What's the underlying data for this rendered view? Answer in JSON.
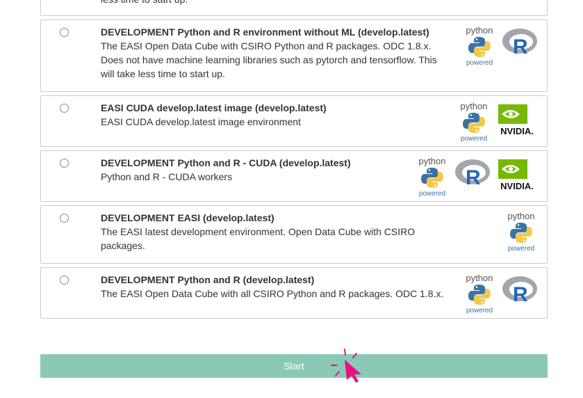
{
  "partial_top": {
    "description": "less time to start up."
  },
  "options": [
    {
      "title": "DEVELOPMENT Python and R environment without ML (develop.latest)",
      "description": "The EASI Open Data Cube with CSIRO Python and R packages. ODC 1.8.x. Does not have machine learning libraries such as pytorch and tensorflow. This will take less time to start up.",
      "logos": [
        "python",
        "r"
      ]
    },
    {
      "title": "EASI CUDA develop.latest image (develop.latest)",
      "description": "EASI CUDA develop.latest image environment",
      "logos": [
        "python",
        "nvidia"
      ]
    },
    {
      "title": "DEVELOPMENT Python and R - CUDA (develop.latest)",
      "description": "Python and R - CUDA workers",
      "logos": [
        "python",
        "r",
        "nvidia"
      ]
    },
    {
      "title": "DEVELOPMENT EASI (develop.latest)",
      "description": "The EASI latest development environment. Open Data Cube with CSIRO packages.",
      "logos": [
        "python"
      ]
    },
    {
      "title": "DEVELOPMENT Python and R (develop.latest)",
      "description": "The EASI Open Data Cube with all CSIRO Python and R packages. ODC 1.8.x.",
      "logos": [
        "python",
        "r"
      ]
    }
  ],
  "logo_text": {
    "python_top": "python",
    "python_bottom": "powered",
    "nvidia": "NVIDIA."
  },
  "start_button": {
    "label": "Start"
  },
  "colors": {
    "accent": "#8bc9b7",
    "cursor": "#e6127e",
    "nvidia": "#76b900",
    "r_blue": "#2266b8"
  }
}
